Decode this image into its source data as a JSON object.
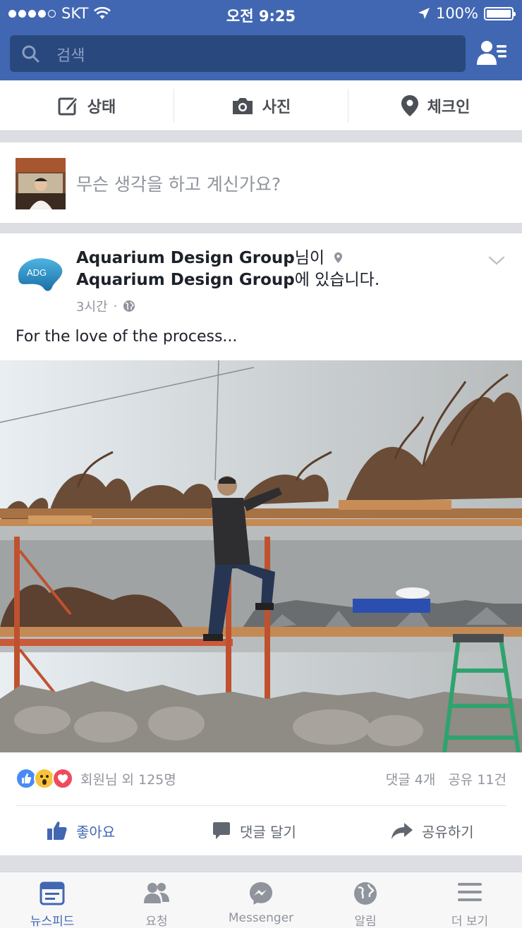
{
  "status_bar": {
    "carrier": "SKT",
    "time": "오전 9:25",
    "battery": "100%"
  },
  "header": {
    "search_placeholder": "검색",
    "friends_icon": "friend-requests-icon"
  },
  "composer": {
    "status_label": "상태",
    "photo_label": "사진",
    "checkin_label": "체크인"
  },
  "prompt": {
    "placeholder": "무슨 생각을 하고 계신가요?"
  },
  "post": {
    "author_name": "Aquarium Design Group",
    "author_suffix": "님이",
    "place_name": "Aquarium Design Group",
    "place_suffix": "에 있습니다.",
    "logo_text": "ADG",
    "time": "3시간",
    "separator": "·",
    "body": "For the love of the process...",
    "reactions_text": "회원님 외 125명",
    "comments_count": "댓글 4개",
    "shares_count": "공유 11건",
    "like_label": "좋아요",
    "comment_label": "댓글 달기",
    "share_label": "공유하기"
  },
  "tabbar": {
    "tabs": [
      {
        "label": "뉴스피드",
        "icon": "news-feed-icon",
        "active": true
      },
      {
        "label": "요청",
        "icon": "requests-icon",
        "active": false
      },
      {
        "label": "Messenger",
        "icon": "messenger-icon",
        "active": false
      },
      {
        "label": "알림",
        "icon": "notifications-icon",
        "active": false
      },
      {
        "label": "더 보기",
        "icon": "more-icon",
        "active": false
      }
    ]
  },
  "colors": {
    "brand": "#4267b2",
    "search_bg": "#29487d",
    "muted_text": "#90949c"
  }
}
